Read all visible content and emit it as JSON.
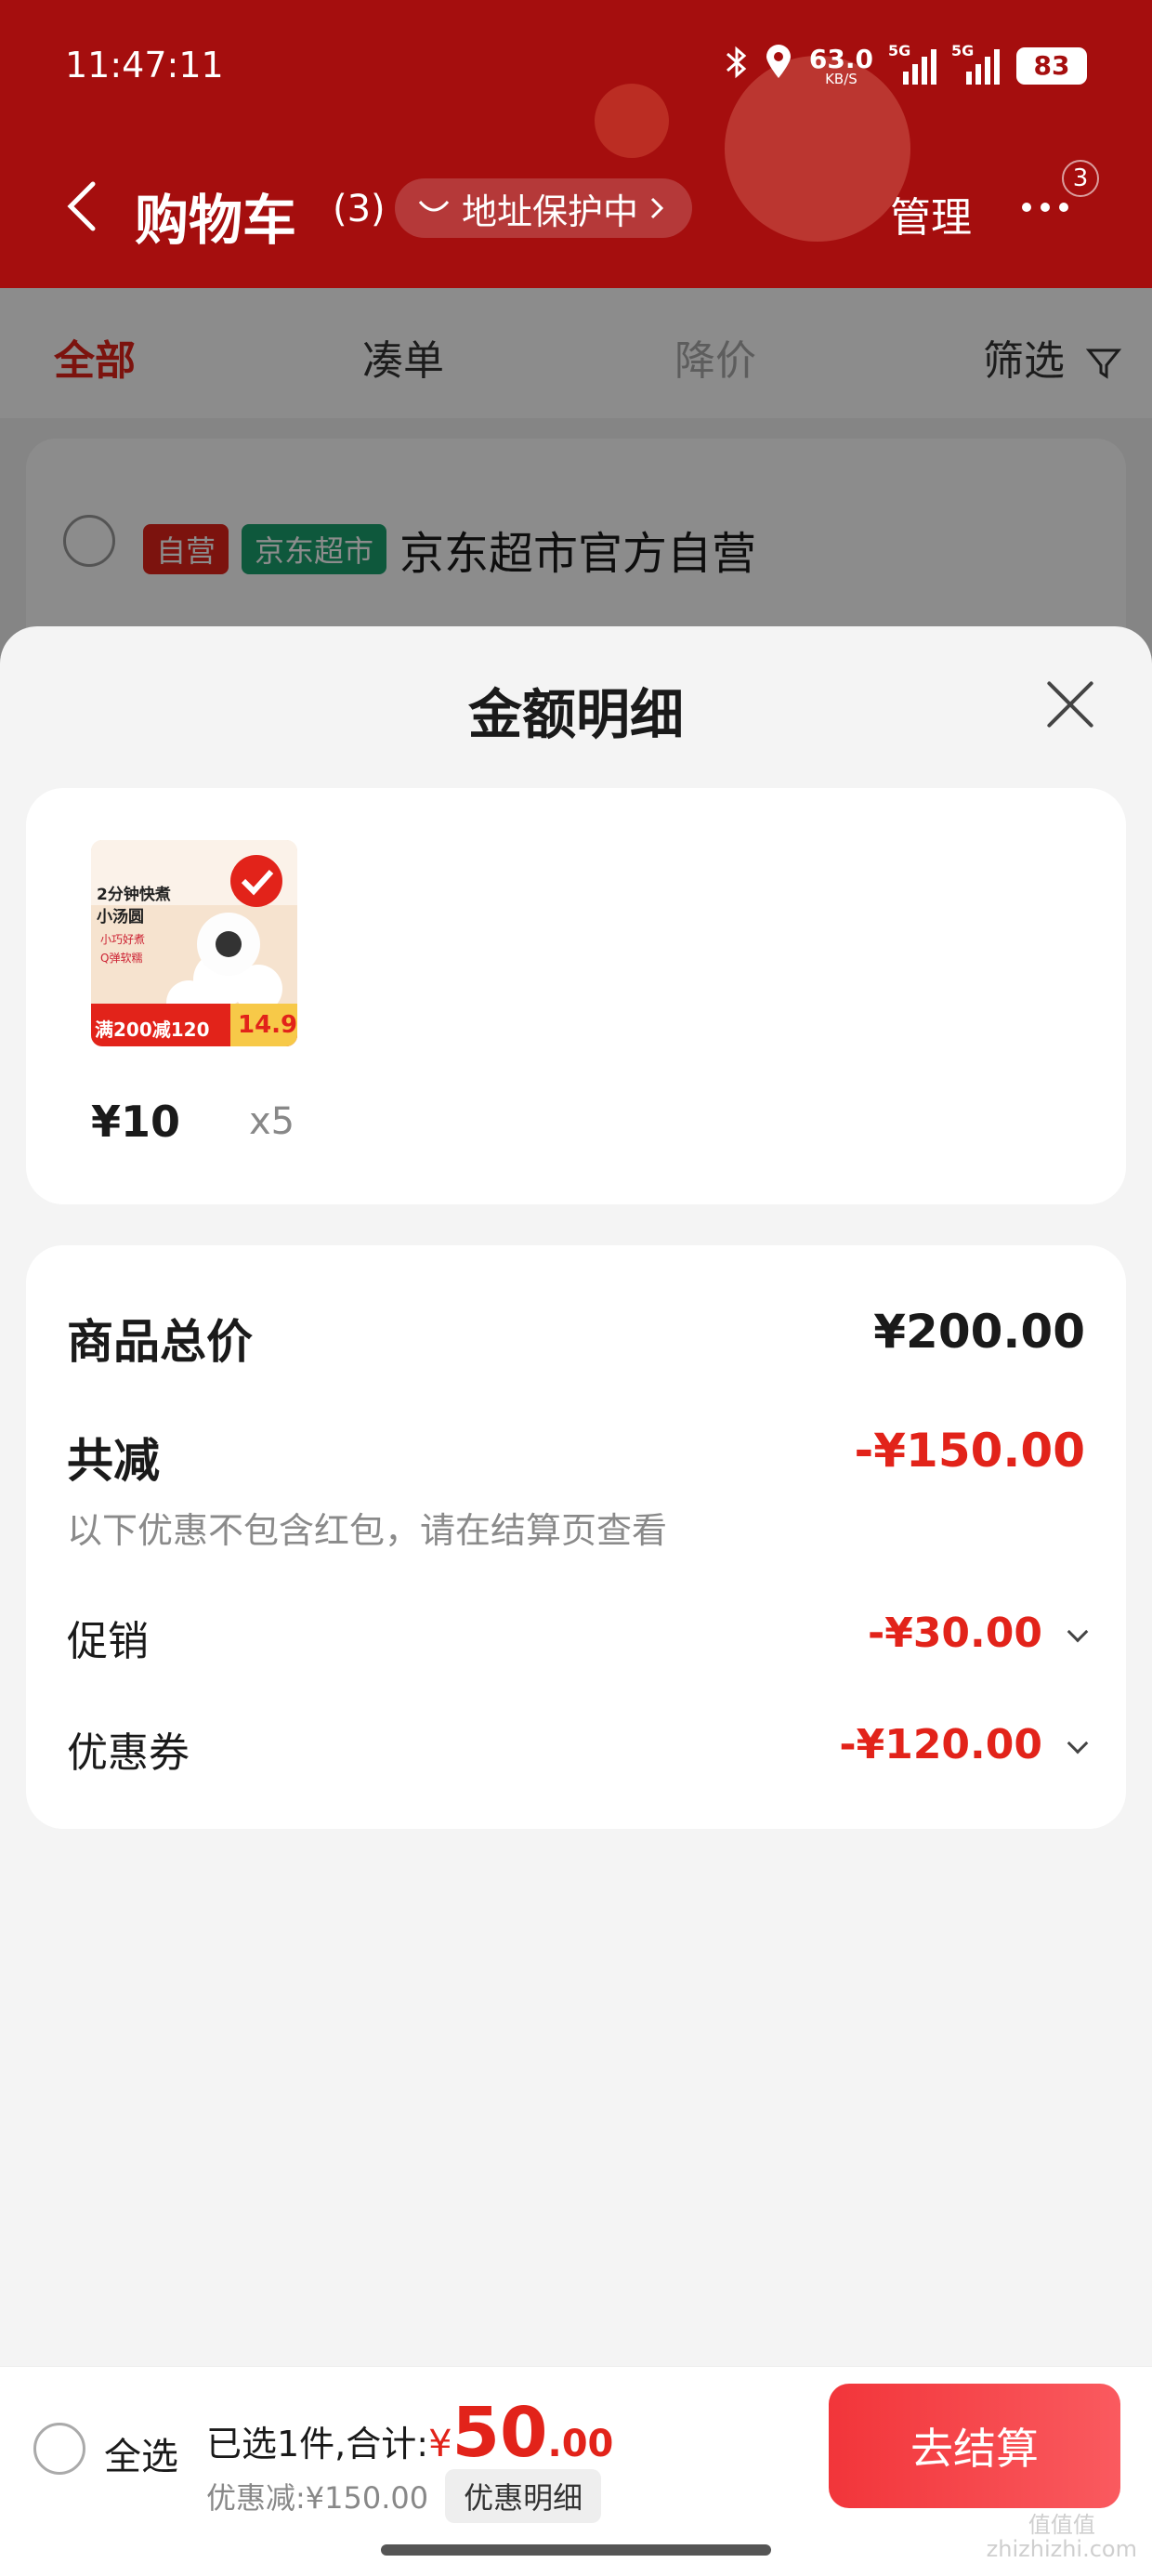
{
  "status_bar": {
    "time": "11:47:11",
    "net_speed": "63.0",
    "net_unit": "KB/S",
    "signal1_tag": "5G",
    "signal2_tag": "5G",
    "battery": "83"
  },
  "header": {
    "title": "购物车",
    "count": "(3)",
    "address_protect": "地址保护中",
    "manage": "管理",
    "more_badge": "3"
  },
  "tabs": [
    {
      "label": "全部"
    },
    {
      "label": "凑单"
    },
    {
      "label": "降价"
    },
    {
      "label": "筛选"
    }
  ],
  "store": {
    "tag_self": "自营",
    "tag_market": "京东超市",
    "name": "京东超市官方自营"
  },
  "sheet": {
    "title": "金额明细",
    "product": {
      "img_line1": "2分钟快煮",
      "img_line2": "小汤圆",
      "img_feature1": "小巧好煮",
      "img_feature2": "Q弹软糯",
      "img_promo": "满200减120",
      "img_price": "14.9",
      "price": "¥10",
      "qty": "x5"
    },
    "summary": {
      "total_label": "商品总价",
      "total_value": "¥200.00",
      "reduce_label": "共减",
      "reduce_value": "-¥150.00",
      "note": "以下优惠不包含红包，请在结算页查看",
      "promo_label": "促销",
      "promo_value": "-¥30.00",
      "coupon_label": "优惠券",
      "coupon_value": "-¥120.00"
    }
  },
  "bottom_bar": {
    "select_all": "全选",
    "selected_text": "已选1件,合计:",
    "currency": "¥",
    "total_int": "50",
    "total_dec": ".00",
    "discount_text": "优惠减:¥150.00",
    "detail_button": "优惠明细",
    "checkout": "去结算"
  },
  "watermark": {
    "line1": "值值值",
    "line2": "zhizhizhi.com"
  },
  "colors": {
    "header_bg": "#a50e0e",
    "accent_red": "#e2231a",
    "checkout_bg": "#f2353a"
  }
}
